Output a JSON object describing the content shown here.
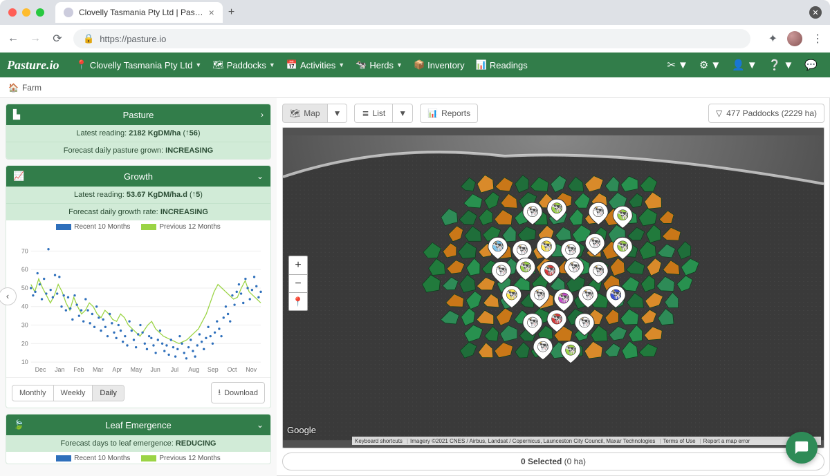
{
  "browser": {
    "tab_title": "Clovelly Tasmania Pty Ltd | Pas…",
    "url": "https://pasture.io"
  },
  "header": {
    "brand": "Pasture.io",
    "farm_selector": "Clovelly Tasmania Pty Ltd",
    "nav": {
      "paddocks": "Paddocks",
      "activities": "Activities",
      "herds": "Herds",
      "inventory": "Inventory",
      "readings": "Readings"
    }
  },
  "breadcrumb": {
    "farm": "Farm"
  },
  "panels": {
    "pasture": {
      "title": "Pasture",
      "latest_label": "Latest reading:",
      "latest_value": "2182 KgDM/ha",
      "delta": "56",
      "forecast_label": "Forecast daily pasture grown:",
      "forecast_value": "INCREASING"
    },
    "growth": {
      "title": "Growth",
      "latest_label": "Latest reading:",
      "latest_value": "53.67 KgDM/ha.d",
      "delta": "5",
      "forecast_label": "Forecast daily growth rate:",
      "forecast_value": "INCREASING",
      "legend_recent": "Recent 10 Months",
      "legend_prev": "Previous 12 Months",
      "seg_monthly": "Monthly",
      "seg_weekly": "Weekly",
      "seg_daily": "Daily",
      "download": "Download"
    },
    "leaf": {
      "title": "Leaf Emergence",
      "forecast_label": "Forecast days to leaf emergence:",
      "forecast_value": "REDUCING",
      "legend_recent": "Recent 10 Months",
      "legend_prev": "Previous 12 Months"
    }
  },
  "map_toolbar": {
    "map": "Map",
    "list": "List",
    "reports": "Reports",
    "paddock_count": "477 Paddocks (2229 ha)"
  },
  "map_footer": {
    "selected": "0 Selected",
    "selected_area": "(0 ha)"
  },
  "map_attrib": {
    "a": "Keyboard shortcuts",
    "b": "Imagery ©2021 CNES / Airbus, Landsat / Copernicus, Launceston City Council, Maxar Technologies",
    "c": "Terms of Use",
    "d": "Report a map error"
  },
  "chart_data": {
    "type": "scatter",
    "title": "Growth",
    "ylabel": "KgDM/ha.d",
    "ylim": [
      10,
      75
    ],
    "yticks": [
      10,
      20,
      30,
      40,
      50,
      60,
      70
    ],
    "categories": [
      "Dec",
      "Jan",
      "Feb",
      "Mar",
      "Apr",
      "May",
      "Jun",
      "Jul",
      "Aug",
      "Sep",
      "Oct",
      "Nov"
    ],
    "series": [
      {
        "name": "Previous 12 Months",
        "style": "line",
        "color": "#9bd445",
        "values": [
          52,
          48,
          55,
          50,
          46,
          42,
          46,
          52,
          48,
          42,
          38,
          45,
          40,
          36,
          38,
          42,
          40,
          36,
          34,
          38,
          36,
          33,
          32,
          36,
          34,
          30,
          28,
          26,
          24,
          27,
          30,
          32,
          28,
          26,
          24,
          23,
          22,
          21,
          20,
          21,
          22,
          24,
          26,
          28,
          32,
          36,
          42,
          48,
          52,
          50,
          48,
          46,
          44,
          45,
          50,
          54,
          48,
          46,
          44,
          42
        ]
      },
      {
        "name": "Recent 10 Months",
        "style": "points",
        "color": "#2e6fbb",
        "values": [
          50,
          46,
          48,
          58,
          52,
          44,
          55,
          47,
          71,
          49,
          45,
          57,
          47,
          56,
          40,
          46,
          38,
          45,
          39,
          33,
          46,
          41,
          35,
          38,
          32,
          44,
          38,
          31,
          36,
          29,
          40,
          34,
          27,
          33,
          29,
          24,
          36,
          31,
          26,
          23,
          30,
          27,
          21,
          24,
          19,
          32,
          27,
          22,
          18,
          25,
          30,
          26,
          20,
          17,
          24,
          23,
          19,
          15,
          22,
          27,
          20,
          16,
          19,
          14,
          22,
          18,
          13,
          17,
          24,
          20,
          15,
          12,
          18,
          22,
          16,
          13,
          19,
          25,
          21,
          17,
          23,
          29,
          24,
          20,
          26,
          32,
          28,
          24,
          34,
          40,
          36,
          32,
          46,
          41,
          48,
          52,
          47,
          42,
          55,
          50,
          44,
          49,
          56,
          51,
          45,
          48
        ]
      }
    ]
  }
}
